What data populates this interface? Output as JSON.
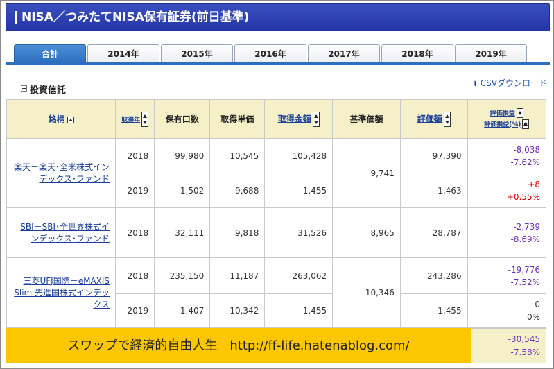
{
  "title": "NISA／つみたてNISA保有証券(前日基準)",
  "tabs": [
    {
      "label": "合計",
      "active": true
    },
    {
      "label": "2014年"
    },
    {
      "label": "2015年"
    },
    {
      "label": "2016年"
    },
    {
      "label": "2017年"
    },
    {
      "label": "2018年"
    },
    {
      "label": "2019年"
    }
  ],
  "section": {
    "label": "投資信託"
  },
  "csv": {
    "label": "CSVダウンロード",
    "icon": "download-arrow-icon"
  },
  "columns": {
    "name": "銘柄",
    "acq_year": "取得年",
    "units": "保有口数",
    "acq_price": "取得単価",
    "acq_amount": "取得金額",
    "base_price": "基準価額",
    "valuation": "評価額",
    "pl": "評価損益",
    "pl_pct": "評価損益(%)"
  },
  "holdings": [
    {
      "name": "楽天－楽天･全米株式インデックス･ファンド",
      "base_price": "9,741",
      "rows": [
        {
          "year": "2018",
          "units": "99,980",
          "acq_price": "10,545",
          "acq_amount": "105,428",
          "valuation": "97,390",
          "pl": "-8,038",
          "pl_pct": "-7.62%"
        },
        {
          "year": "2019",
          "units": "1,502",
          "acq_price": "9,688",
          "acq_amount": "1,455",
          "valuation": "1,463",
          "pl": "+8",
          "pl_pct": "+0.55%"
        }
      ]
    },
    {
      "name": "SBI－SBI･全世界株式インデックス･ファンド",
      "base_price": "8,965",
      "rows": [
        {
          "year": "2018",
          "units": "32,111",
          "acq_price": "9,818",
          "acq_amount": "31,526",
          "valuation": "28,787",
          "pl": "-2,739",
          "pl_pct": "-8.69%"
        }
      ]
    },
    {
      "name": "三菱UFJ国際－eMAXIS Slim 先進国株式インデックス",
      "base_price": "10,346",
      "rows": [
        {
          "year": "2018",
          "units": "235,150",
          "acq_price": "11,187",
          "acq_amount": "263,062",
          "valuation": "243,286",
          "pl": "-19,776",
          "pl_pct": "-7.52%"
        },
        {
          "year": "2019",
          "units": "1,407",
          "acq_price": "10,342",
          "acq_amount": "1,455",
          "valuation": "1,455",
          "pl": "0",
          "pl_pct": "0%"
        }
      ]
    }
  ],
  "total": {
    "pl": "-30,545",
    "pl_pct": "-7.58%"
  },
  "banner": {
    "text": "スワップで経済的自由人生　http://ff-life.hatenablog.com/"
  },
  "colors": {
    "title_bg": "#2a3cb0",
    "tab_active": "#2d6fbf",
    "header_bg": "#f6f0c9",
    "banner_bg": "#fcc600",
    "negative": "#6b2fbf",
    "positive": "#e00000",
    "link": "#1a3f9b"
  }
}
